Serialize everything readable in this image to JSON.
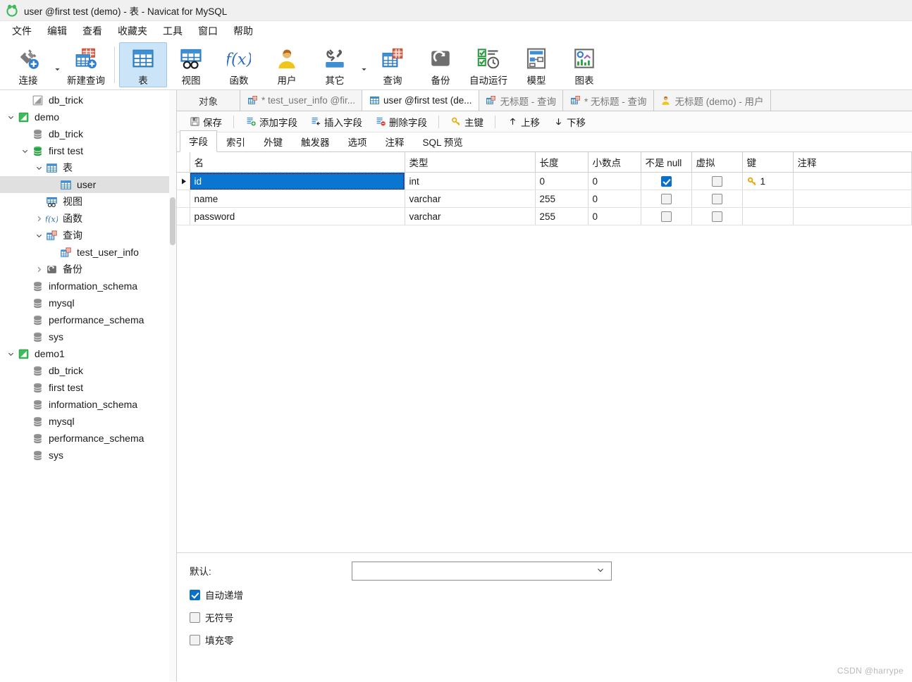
{
  "window": {
    "title": "user @first test (demo) - 表 - Navicat for MySQL",
    "logo_icon": "navicat-logo-icon"
  },
  "menubar": {
    "items": [
      {
        "label": "文件",
        "name": "menu-file"
      },
      {
        "label": "编辑",
        "name": "menu-edit"
      },
      {
        "label": "查看",
        "name": "menu-view"
      },
      {
        "label": "收藏夹",
        "name": "menu-favorites"
      },
      {
        "label": "工具",
        "name": "menu-tools"
      },
      {
        "label": "窗口",
        "name": "menu-window"
      },
      {
        "label": "帮助",
        "name": "menu-help"
      }
    ]
  },
  "toolbar": {
    "buttons": [
      {
        "label": "连接",
        "icon": "connection-icon",
        "active": false,
        "caret": true
      },
      {
        "label": "新建查询",
        "icon": "new-query-icon",
        "active": false,
        "caret": false
      },
      {
        "label": "表",
        "icon": "table-icon",
        "active": true,
        "caret": false
      },
      {
        "label": "视图",
        "icon": "view-icon",
        "active": false,
        "caret": false
      },
      {
        "label": "函数",
        "icon": "function-icon",
        "active": false,
        "caret": false
      },
      {
        "label": "用户",
        "icon": "user-icon",
        "active": false,
        "caret": false
      },
      {
        "label": "其它",
        "icon": "other-tools-icon",
        "active": false,
        "caret": true
      },
      {
        "label": "查询",
        "icon": "query-icon",
        "active": false,
        "caret": false
      },
      {
        "label": "备份",
        "icon": "backup-icon",
        "active": false,
        "caret": false
      },
      {
        "label": "自动运行",
        "icon": "automation-icon",
        "active": false,
        "caret": false
      },
      {
        "label": "模型",
        "icon": "model-icon",
        "active": false,
        "caret": false
      },
      {
        "label": "图表",
        "icon": "chart-icon",
        "active": false,
        "caret": false
      }
    ]
  },
  "sidebar": {
    "items": [
      {
        "label": "db_trick",
        "indent": 1,
        "icon": "connection-gray-icon",
        "twisty": "",
        "selected": false
      },
      {
        "label": "demo",
        "indent": 0,
        "icon": "connection-green-icon",
        "twisty": "down",
        "selected": false
      },
      {
        "label": "db_trick",
        "indent": 1,
        "icon": "database-gray-icon",
        "twisty": "",
        "selected": false
      },
      {
        "label": "first test",
        "indent": 1,
        "icon": "database-green-icon",
        "twisty": "down",
        "selected": false
      },
      {
        "label": "表",
        "indent": 2,
        "icon": "table-icon",
        "twisty": "down",
        "selected": false
      },
      {
        "label": "user",
        "indent": 3,
        "icon": "table-icon",
        "twisty": "",
        "selected": true
      },
      {
        "label": "视图",
        "indent": 2,
        "icon": "view-icon",
        "twisty": "",
        "selected": false
      },
      {
        "label": "函数",
        "indent": 2,
        "icon": "function-icon",
        "twisty": "right",
        "selected": false
      },
      {
        "label": "查询",
        "indent": 2,
        "icon": "query-icon",
        "twisty": "down",
        "selected": false
      },
      {
        "label": "test_user_info",
        "indent": 3,
        "icon": "query-icon",
        "twisty": "",
        "selected": false
      },
      {
        "label": "备份",
        "indent": 2,
        "icon": "backup-icon",
        "twisty": "right",
        "selected": false
      },
      {
        "label": "information_schema",
        "indent": 1,
        "icon": "database-gray-icon",
        "twisty": "",
        "selected": false
      },
      {
        "label": "mysql",
        "indent": 1,
        "icon": "database-gray-icon",
        "twisty": "",
        "selected": false
      },
      {
        "label": "performance_schema",
        "indent": 1,
        "icon": "database-gray-icon",
        "twisty": "",
        "selected": false
      },
      {
        "label": "sys",
        "indent": 1,
        "icon": "database-gray-icon",
        "twisty": "",
        "selected": false
      },
      {
        "label": "demo1",
        "indent": 0,
        "icon": "connection-green-icon",
        "twisty": "down",
        "selected": false
      },
      {
        "label": "db_trick",
        "indent": 1,
        "icon": "database-gray-icon",
        "twisty": "",
        "selected": false
      },
      {
        "label": "first test",
        "indent": 1,
        "icon": "database-gray-icon",
        "twisty": "",
        "selected": false
      },
      {
        "label": "information_schema",
        "indent": 1,
        "icon": "database-gray-icon",
        "twisty": "",
        "selected": false
      },
      {
        "label": "mysql",
        "indent": 1,
        "icon": "database-gray-icon",
        "twisty": "",
        "selected": false
      },
      {
        "label": "performance_schema",
        "indent": 1,
        "icon": "database-gray-icon",
        "twisty": "",
        "selected": false
      },
      {
        "label": "sys",
        "indent": 1,
        "icon": "database-gray-icon",
        "twisty": "",
        "selected": false
      }
    ]
  },
  "tabstrip": {
    "object_tab": "对象",
    "tabs": [
      {
        "label": "* test_user_info @fir...",
        "icon": "query-icon",
        "active": false
      },
      {
        "label": "user @first test (de...",
        "icon": "table-icon",
        "active": true
      },
      {
        "label": "无标题 - 查询",
        "icon": "query-icon",
        "active": false
      },
      {
        "label": "* 无标题 - 查询",
        "icon": "query-icon",
        "active": false
      },
      {
        "label": "无标题 (demo) - 用户",
        "icon": "user-icon",
        "active": false
      }
    ]
  },
  "actionbar": {
    "buttons": [
      {
        "label": "保存",
        "icon": "save-icon"
      },
      {
        "label": "添加字段",
        "icon": "add-field-icon"
      },
      {
        "label": "插入字段",
        "icon": "insert-field-icon"
      },
      {
        "label": "删除字段",
        "icon": "delete-field-icon"
      },
      {
        "label": "主键",
        "icon": "primary-key-icon"
      },
      {
        "label": "上移",
        "icon": "arrow-up-icon"
      },
      {
        "label": "下移",
        "icon": "arrow-down-icon"
      }
    ]
  },
  "subtabs": {
    "items": [
      {
        "label": "字段",
        "active": true
      },
      {
        "label": "索引",
        "active": false
      },
      {
        "label": "外键",
        "active": false
      },
      {
        "label": "触发器",
        "active": false
      },
      {
        "label": "选项",
        "active": false
      },
      {
        "label": "注释",
        "active": false
      },
      {
        "label": "SQL 预览",
        "active": false
      }
    ]
  },
  "grid": {
    "columns": [
      "名",
      "类型",
      "长度",
      "小数点",
      "不是 null",
      "虚拟",
      "键",
      "注释"
    ],
    "rows": [
      {
        "name": "id",
        "type": "int",
        "length": "0",
        "decimals": "0",
        "not_null": true,
        "virtual": false,
        "key": "1",
        "comment": "",
        "selected": true
      },
      {
        "name": "name",
        "type": "varchar",
        "length": "255",
        "decimals": "0",
        "not_null": false,
        "virtual": false,
        "key": "",
        "comment": "",
        "selected": false
      },
      {
        "name": "password",
        "type": "varchar",
        "length": "255",
        "decimals": "0",
        "not_null": false,
        "virtual": false,
        "key": "",
        "comment": "",
        "selected": false
      }
    ]
  },
  "properties": {
    "default_label": "默认:",
    "default_value": "",
    "checkboxes": [
      {
        "label": "自动递增",
        "checked": true
      },
      {
        "label": "无符号",
        "checked": false
      },
      {
        "label": "填充零",
        "checked": false
      }
    ]
  },
  "watermark": "CSDN @harrype",
  "colors": {
    "accent_blue": "#0a6fc6",
    "selection_blue": "#0a76d2",
    "toolbar_active": "#cce4f7",
    "tree_selected": "#e0e0e0",
    "key_gold": "#eaa900"
  }
}
